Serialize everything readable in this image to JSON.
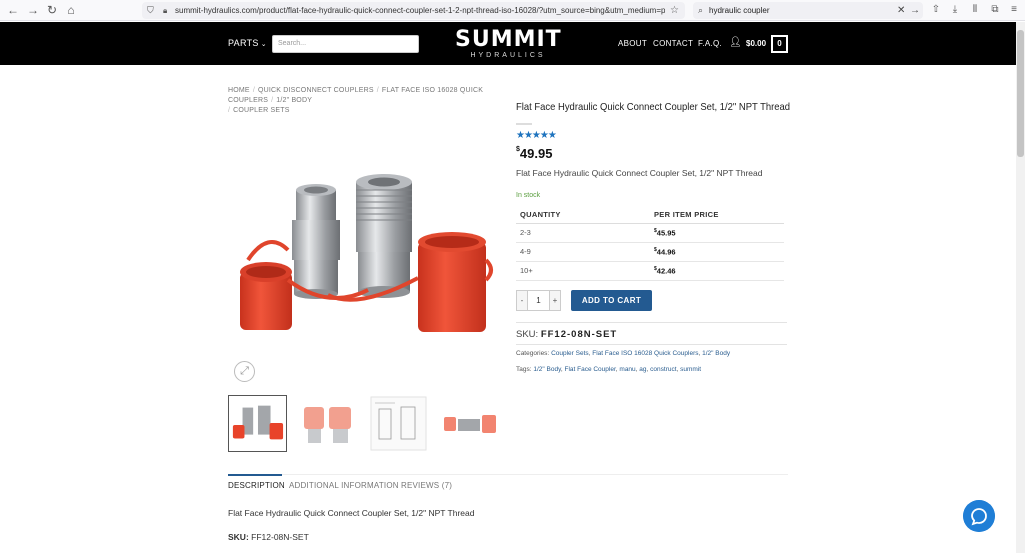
{
  "browser": {
    "url": "summit-hydraulics.com/product/flat-face-hydraulic-quick-connect-coupler-set-1-2-npt-thread-iso-16028/?utm_source=bing&utm_medium=paid&utm",
    "search_query": "hydraulic coupler"
  },
  "header": {
    "parts_label": "PARTS",
    "search_placeholder": "Search...",
    "logo_main": "SUMMIT",
    "logo_sub": "HYDRAULICS",
    "nav": [
      "ABOUT",
      "CONTACT",
      "F.A.Q."
    ],
    "cart_total": "$0.00",
    "cart_count": "0"
  },
  "breadcrumb": [
    "HOME",
    "QUICK DISCONNECT COUPLERS",
    "FLAT FACE ISO 16028 QUICK COUPLERS",
    "1/2\" BODY",
    "COUPLER SETS"
  ],
  "product": {
    "title": "Flat Face Hydraulic Quick Connect Coupler Set, 1/2\" NPT Thread",
    "rating_stars": 5,
    "price_currency": "$",
    "price_amount": "49.95",
    "short_description": "Flat Face Hydraulic Quick Connect Coupler Set, 1/2\" NPT Thread",
    "stock": "In stock",
    "qty_value": "1",
    "add_to_cart": "ADD TO CART",
    "sku_label": "SKU:",
    "sku_value": "FF12-08N-SET",
    "categories_label": "Categories:",
    "categories": [
      "Coupler Sets",
      "Flat Face ISO 16028 Quick Couplers",
      "1/2\" Body"
    ],
    "tags_label": "Tags:",
    "tags": [
      "1/2\" Body",
      "Flat Face Coupler",
      "manu",
      "ag",
      "construct",
      "summit"
    ]
  },
  "price_table": {
    "headers": [
      "QUANTITY",
      "PER ITEM PRICE"
    ],
    "rows": [
      {
        "qty": "2-3",
        "price": "45.95"
      },
      {
        "qty": "4-9",
        "price": "44.96"
      },
      {
        "qty": "10+",
        "price": "42.46"
      }
    ]
  },
  "tabs": [
    "DESCRIPTION",
    "ADDITIONAL INFORMATION",
    "REVIEWS (7)"
  ],
  "description": {
    "text": "Flat Face Hydraulic Quick Connect Coupler Set, 1/2\" NPT Thread",
    "sku_label": "SKU:",
    "sku_value": "FF12-08N-SET"
  },
  "colors": {
    "accent": "#235a91",
    "stars": "#1e73be",
    "in_stock": "#5a9e3e",
    "cap_red": "#e8432a",
    "chat": "#1f7ed6"
  }
}
